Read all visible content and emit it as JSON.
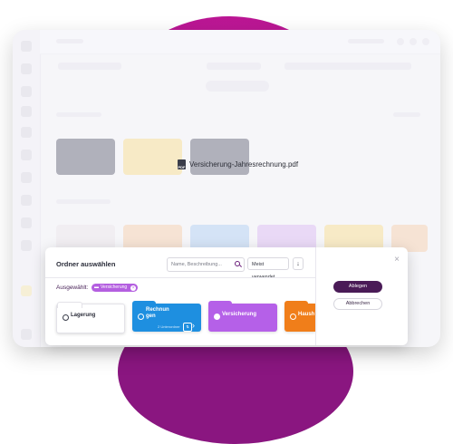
{
  "file": {
    "name": "Versicherung-Jahresrechnung.pdf",
    "icon": "pdf-icon",
    "badge": "PDF"
  },
  "dialog": {
    "title": "Ordner auswählen",
    "search_placeholder": "Name, Beschreibung...",
    "sort_label": "Meist verwendet",
    "sort_direction": "↓",
    "selected_label": "Ausgewählt:",
    "selected_chip": "Versicherung",
    "primary_button": "Ablegen",
    "secondary_button": "Abbrechen",
    "close": "×"
  },
  "folders": [
    {
      "name": "Lagerung",
      "color": "#ffffff"
    },
    {
      "name": "Rechnungen",
      "name_line1": "Rechnun",
      "name_line2": "gen",
      "color": "#1e8fe0",
      "sub": "2 Unterordner",
      "arrow": "›"
    },
    {
      "name": "Versicherung",
      "color": "#b560e8",
      "selected": true
    },
    {
      "name": "Haushalt",
      "name_visible": "Haush",
      "color": "#f07e1a"
    }
  ],
  "colors": {
    "accent": "#4a1b57",
    "brand": "#c6189b",
    "chip": "#b45fe0"
  }
}
